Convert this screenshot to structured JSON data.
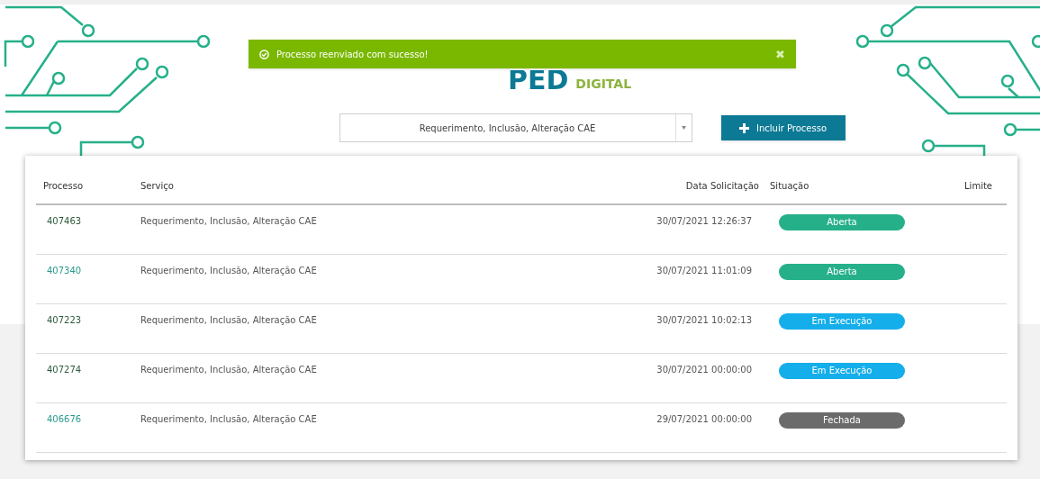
{
  "toast": {
    "message": "Processo reenviado com sucesso!",
    "close": "✖"
  },
  "logo": {
    "letters": "PED",
    "subtitle": "DIGITAL"
  },
  "service_select": {
    "value": "Requerimento, Inclusão, Alteração CAE"
  },
  "add_button": {
    "label": "Incluir Processo"
  },
  "table": {
    "columns": [
      "Processo",
      "Serviço",
      "Data Solicitação",
      "Situação",
      "Limite"
    ],
    "rows": [
      {
        "process": "407463",
        "visited": false,
        "service": "Requerimento, Inclusão, Alteração CAE",
        "date": "30/07/2021 12:26:37",
        "status": "Aberta",
        "color": "#26b08a"
      },
      {
        "process": "407340",
        "visited": true,
        "service": "Requerimento, Inclusão, Alteração CAE",
        "date": "30/07/2021 11:01:09",
        "status": "Aberta",
        "color": "#26b08a"
      },
      {
        "process": "407223",
        "visited": false,
        "service": "Requerimento, Inclusão, Alteração CAE",
        "date": "30/07/2021 10:02:13",
        "status": "Em Execução",
        "color": "#14aeea"
      },
      {
        "process": "407274",
        "visited": false,
        "service": "Requerimento, Inclusão, Alteração CAE",
        "date": "30/07/2021 00:00:00",
        "status": "Em Execução",
        "color": "#14aeea"
      },
      {
        "process": "406676",
        "visited": true,
        "service": "Requerimento, Inclusão, Alteração CAE",
        "date": "29/07/2021 00:00:00",
        "status": "Fechada",
        "color": "#6b6b6b"
      }
    ]
  }
}
